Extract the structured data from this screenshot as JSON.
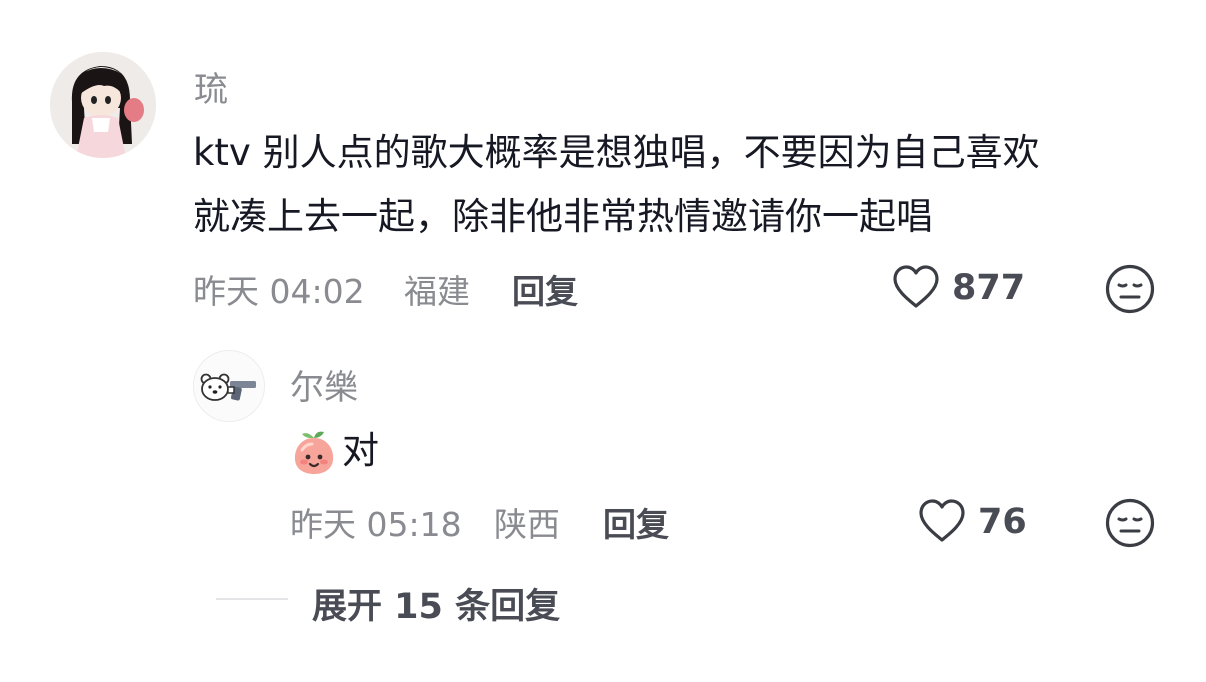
{
  "comment": {
    "username": "琉",
    "text_line1": "ktv 别人点的歌大概率是想独唱，不要因为自己喜欢",
    "text_line2": "就凑上去一起，除非他非常热情邀请你一起唱",
    "time": "昨天 04:02",
    "location": "福建",
    "reply_label": "回复",
    "likes": "877",
    "avatar_icon": "anime-girl-avatar",
    "dislike_icon": "meh-face-icon"
  },
  "reply": {
    "username": "尔樂",
    "text": "对",
    "emoji_icon": "peach-smile-emoji",
    "time": "昨天 05:18",
    "location": "陕西",
    "reply_label": "回复",
    "likes": "76",
    "avatar_icon": "bear-with-gun-avatar"
  },
  "expand": {
    "label": "展开 15 条回复"
  }
}
